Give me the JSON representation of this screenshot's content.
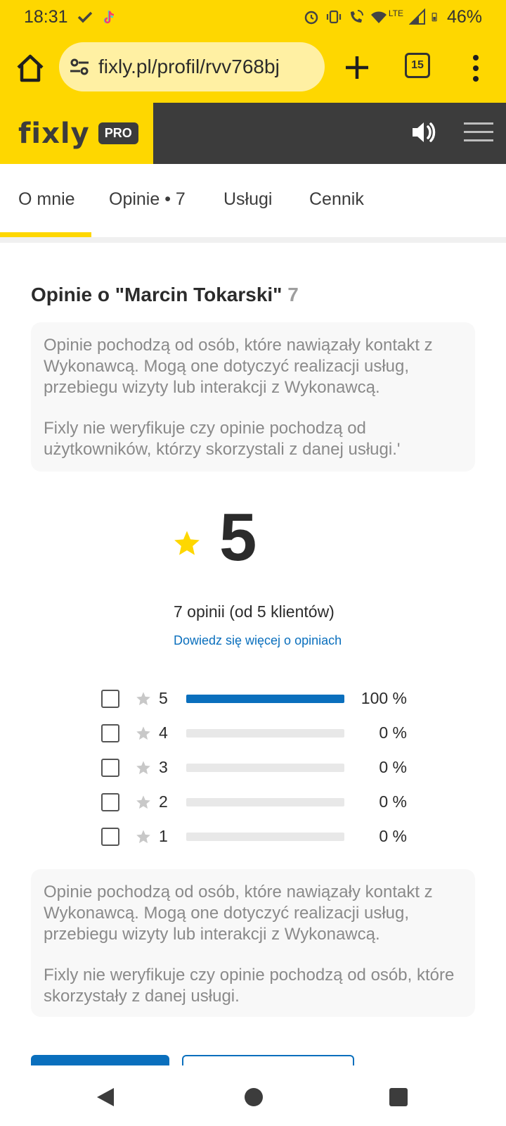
{
  "status_bar": {
    "time": "18:31",
    "battery": "46%",
    "network": "LTE",
    "icons": [
      "check-icon",
      "tiktok-icon",
      "alarm-icon",
      "vibrate-icon",
      "wifi-call-icon",
      "wifi-icon",
      "signal-icon",
      "battery-icon"
    ]
  },
  "browser": {
    "url": "fixly.pl/profil/rvv768bj",
    "tab_count": "15",
    "icons": [
      "home-icon",
      "site-settings-icon",
      "plus-icon",
      "more-vert-icon"
    ]
  },
  "site_header": {
    "logo": "fixly",
    "badge": "PRO",
    "colors": {
      "brand_yellow": "#fed700",
      "dark": "#3c3c3c",
      "accent_blue": "#0a6fbd"
    }
  },
  "tabs": [
    {
      "label": "O mnie",
      "active": true
    },
    {
      "label": "Opinie • 7",
      "active": false
    },
    {
      "label": "Usługi",
      "active": false
    },
    {
      "label": "Cennik",
      "active": false
    }
  ],
  "reviews": {
    "title": "Opinie o \"Marcin Tokarski\"",
    "count": "7",
    "notice_top": [
      "Opinie pochodzą od osób, które nawiązały kontakt z Wykonawcą. Mogą one dotyczyć realizacji usług, przebiegu wizyty lub interakcji z Wykonawcą.",
      "Fixly nie weryfikuje czy opinie pochodzą od użytkowników, którzy skorzystali z danej usługi.'"
    ],
    "score": "5",
    "summary": "7 opinii (od 5 klientów)",
    "learn_more": "Dowiedz się więcej o opiniach",
    "breakdown": [
      {
        "stars": "5",
        "percent_label": "100 %",
        "fraction": 1.0
      },
      {
        "stars": "4",
        "percent_label": "0 %",
        "fraction": 0
      },
      {
        "stars": "3",
        "percent_label": "0 %",
        "fraction": 0
      },
      {
        "stars": "2",
        "percent_label": "0 %",
        "fraction": 0
      },
      {
        "stars": "1",
        "percent_label": "0 %",
        "fraction": 0
      }
    ],
    "notice_bottom": [
      "Opinie pochodzą od osób, które nawiązały kontakt z Wykonawcą. Mogą one dotyczyć realizacji usług, przebiegu wizyty lub interakcji z Wykonawcą.",
      "Fixly nie weryfikuje czy opinie pochodzą od osób, które skorzystały z danej usługi."
    ]
  }
}
